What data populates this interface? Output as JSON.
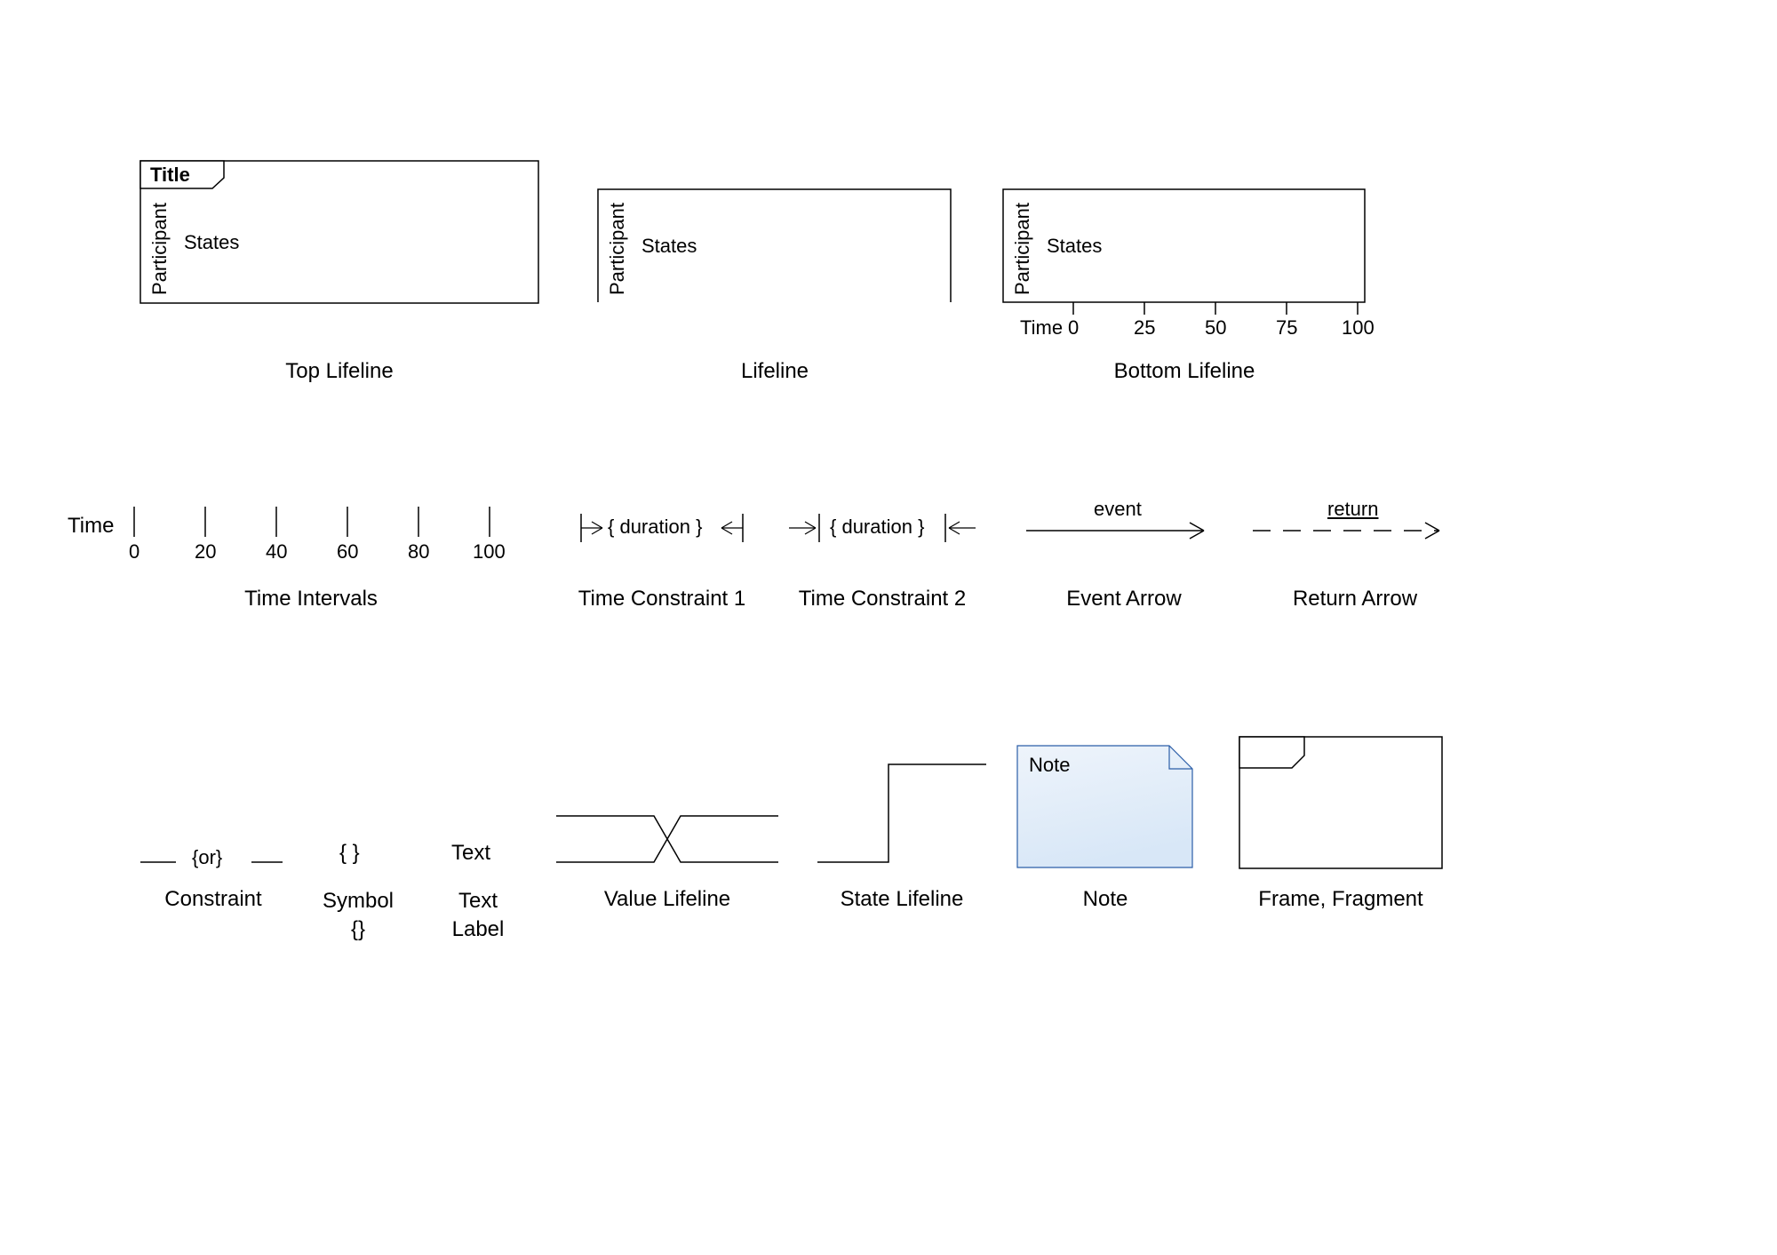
{
  "top_lifeline": {
    "title": "Title",
    "participant": "Participant",
    "states": "States",
    "caption": "Top Lifeline"
  },
  "lifeline": {
    "participant": "Participant",
    "states": "States",
    "caption": "Lifeline"
  },
  "bottom_lifeline": {
    "participant": "Participant",
    "states": "States",
    "time_label": "Time",
    "ticks": [
      "0",
      "25",
      "50",
      "75",
      "100"
    ],
    "caption": "Bottom Lifeline"
  },
  "time_intervals": {
    "label": "Time",
    "ticks": [
      "0",
      "20",
      "40",
      "60",
      "80",
      "100"
    ],
    "caption": "Time Intervals"
  },
  "tc1": {
    "text": "{ duration }",
    "caption": "Time Constraint 1"
  },
  "tc2": {
    "text": "{ duration }",
    "caption": "Time Constraint 2"
  },
  "event_arrow": {
    "label": "event",
    "caption": "Event Arrow"
  },
  "return_arrow": {
    "label": "return",
    "caption": "Return Arrow"
  },
  "constraint": {
    "text": "{or}",
    "caption": "Constraint"
  },
  "symbol": {
    "text": "{ }",
    "caption": "Symbol {}"
  },
  "text_label": {
    "text": "Text",
    "caption": "Text Label"
  },
  "value_lifeline": {
    "caption": "Value Lifeline"
  },
  "state_lifeline": {
    "caption": "State Lifeline"
  },
  "note": {
    "text": "Note",
    "caption": "Note"
  },
  "frame": {
    "caption": "Frame, Fragment"
  }
}
